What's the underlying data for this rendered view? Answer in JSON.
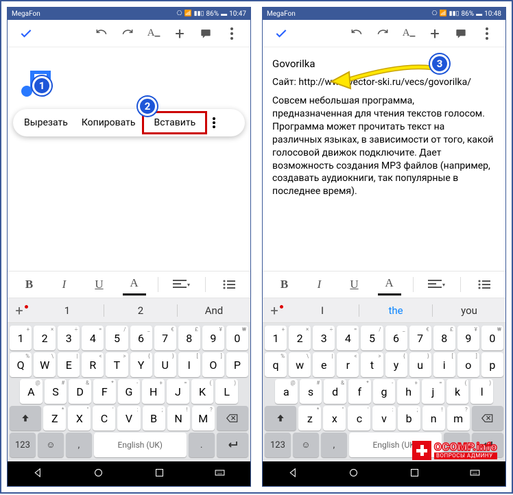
{
  "phone1": {
    "carrier": "MegaFon",
    "time": "10:47",
    "battery": "86%",
    "context_menu": {
      "cut": "Вырезать",
      "copy": "Копировать",
      "paste": "Вставить"
    },
    "suggestions": {
      "s1": "1",
      "s2": "2",
      "s3": "And"
    },
    "keyboard_lang": "English (UK)"
  },
  "phone2": {
    "carrier": "MegaFon",
    "time": "10:48",
    "battery": "86%",
    "doc_title": "Govorilka",
    "doc_site": "Сайт: http://www.vector-ski.ru/vecs/govorilka/",
    "doc_body": "Совсем небольшая программа, предназначенная для чтения текстов голосом. Программа может прочитать текст на различных языках, в зависимости от того, какой голосовой движок подключите. Дает возможность создания MP3 файлов (например, создавать аудиокниги, так популярные в последнее время).",
    "suggestions": {
      "s1": "I",
      "s2": "the",
      "s3": "you"
    },
    "keyboard_lang": "English (UK)"
  },
  "badges": {
    "b1": "1",
    "b2": "2",
    "b3": "3"
  },
  "keys": {
    "row1": [
      "1",
      "2",
      "3",
      "4",
      "5",
      "6",
      "7",
      "8",
      "9",
      "0"
    ],
    "row1_sup": [
      "+",
      "×",
      "÷",
      "=",
      "/",
      "_",
      "€",
      "£",
      "¥",
      "₩"
    ],
    "row2": [
      "Q",
      "W",
      "E",
      "R",
      "T",
      "Y",
      "U",
      "I",
      "O",
      "P"
    ],
    "row2_sup": [
      "%",
      "\\",
      "|",
      "<",
      ">",
      "{",
      "}",
      "[",
      "]",
      ""
    ],
    "row3": [
      "A",
      "S",
      "D",
      "F",
      "G",
      "H",
      "J",
      "K",
      "L"
    ],
    "row3_sup": [
      "@",
      "#",
      "&",
      "*",
      "-",
      "+",
      "=",
      "(",
      ")"
    ],
    "row4": [
      "Z",
      "X",
      "C",
      "V",
      "B",
      "N",
      "M"
    ],
    "row4_sup": [
      "*",
      "\"",
      "'",
      ":",
      ";",
      "!",
      "?"
    ],
    "row2l": [
      "q",
      "w",
      "e",
      "r",
      "t",
      "y",
      "u",
      "i",
      "o",
      "p"
    ],
    "row3l": [
      "a",
      "s",
      "d",
      "f",
      "g",
      "h",
      "j",
      "k",
      "l"
    ],
    "row4l": [
      "z",
      "x",
      "c",
      "v",
      "b",
      "n",
      "m"
    ],
    "n123": "123",
    "comma": ",",
    "period": "."
  },
  "watermark": {
    "main": "OCOMP.info",
    "sub": "ВОПРОСЫ АДМИНУ"
  }
}
